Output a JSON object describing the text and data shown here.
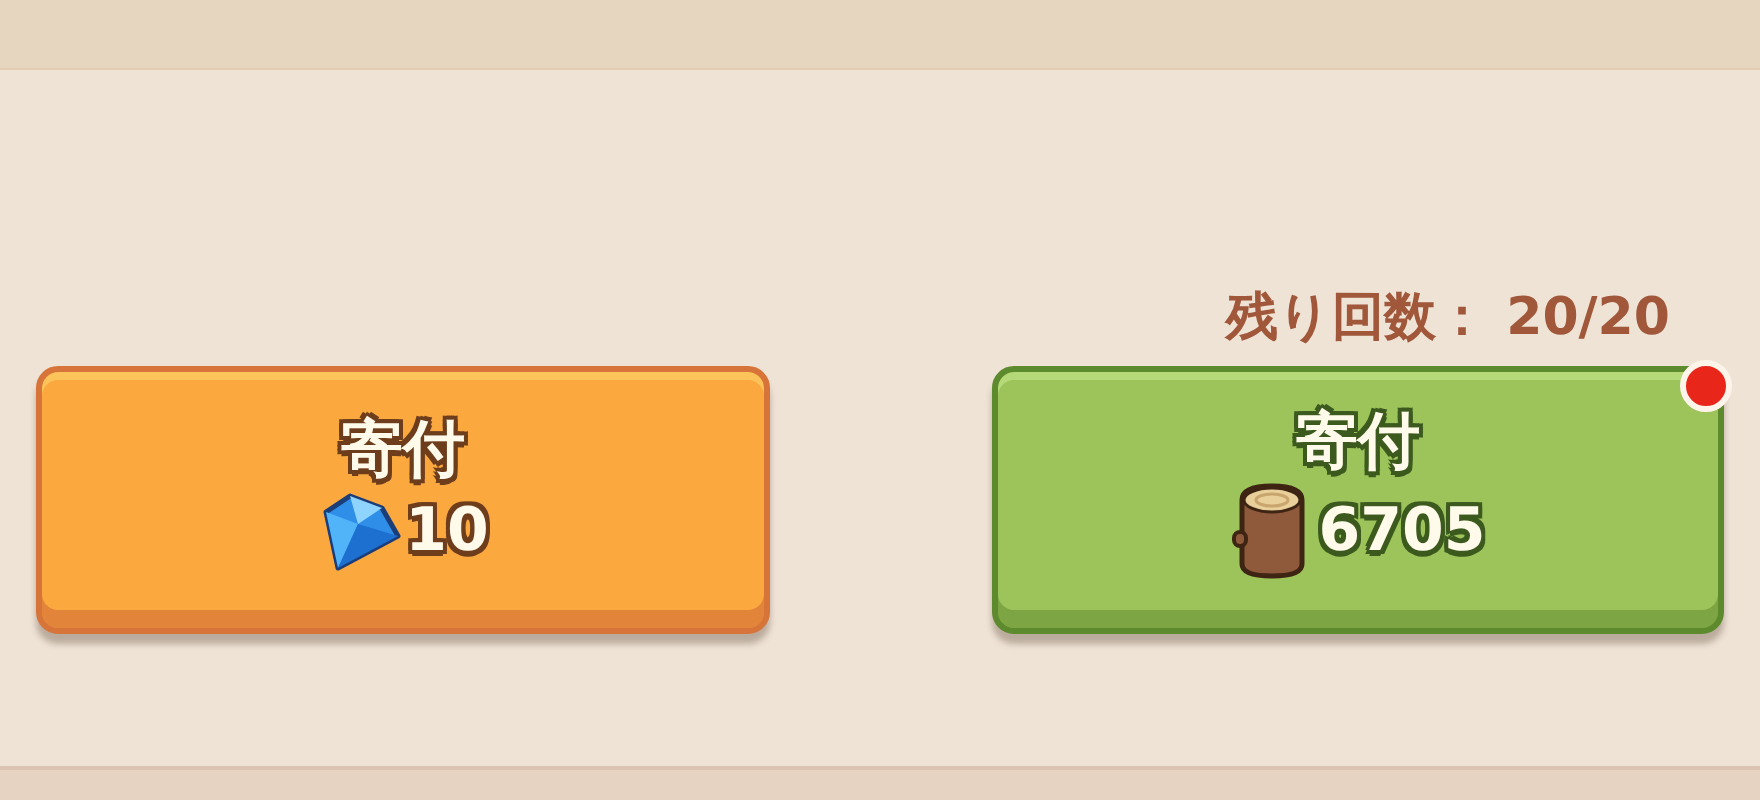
{
  "remaining": "残り回数： 20/20",
  "buttons": [
    {
      "kind": "orange",
      "label": "寄付",
      "cost": {
        "kind": "gem",
        "amount": "10"
      },
      "notification": false
    },
    {
      "kind": "green",
      "label": "寄付",
      "cost": {
        "kind": "wood",
        "amount": "6705"
      },
      "notification": true
    }
  ]
}
